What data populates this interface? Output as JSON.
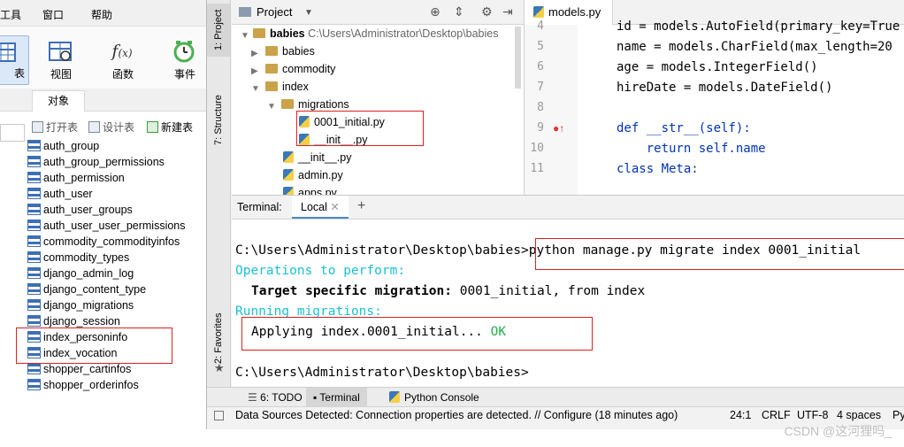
{
  "menubar": {
    "items": [
      "工具",
      "窗口",
      "帮助"
    ]
  },
  "ribbon": {
    "buttons": [
      {
        "label": "表",
        "icon": "table-icon"
      },
      {
        "label": "视图",
        "icon": "view-icon"
      },
      {
        "label": "函数",
        "icon": "function-icon"
      },
      {
        "label": "事件",
        "icon": "event-clock-icon"
      }
    ]
  },
  "objects": {
    "tab_label": "对象",
    "toolbar": {
      "open_table": "打开表",
      "design_table": "设计表",
      "new_table": "新建表"
    },
    "tables": [
      "auth_group",
      "auth_group_permissions",
      "auth_permission",
      "auth_user",
      "auth_user_groups",
      "auth_user_user_permissions",
      "commodity_commodityinfos",
      "commodity_types",
      "django_admin_log",
      "django_content_type",
      "django_migrations",
      "django_session",
      "index_personinfo",
      "index_vocation",
      "shopper_cartinfos",
      "shopper_orderinfos"
    ]
  },
  "ide": {
    "side_tabs": [
      "1: Project",
      "7: Structure",
      "2: Favorites"
    ],
    "project": {
      "title": "Project",
      "root_name": "babies",
      "root_path": "C:\\Users\\Administrator\\Desktop\\babies",
      "items": [
        "babies",
        "commodity",
        "index",
        "migrations",
        "0001_initial.py",
        "__init__.py",
        "__init__.py",
        "admin.py",
        "apps.py"
      ]
    },
    "editor": {
      "tab": "models.py",
      "line_numbers": [
        "4",
        "5",
        "6",
        "7",
        "8",
        "9",
        "10",
        "11"
      ],
      "lines": [
        "id = models.AutoField(primary_key=True",
        "name = models.CharField(max_length=20",
        "age = models.IntegerField()",
        "hireDate = models.DateField()",
        "",
        "def __str__(self):",
        "    return self.name",
        "class Meta:"
      ]
    },
    "terminal": {
      "label": "Terminal:",
      "tab": "Local",
      "add": "+",
      "prompt1": "C:\\Users\\Administrator\\Desktop\\babies>",
      "command": "python manage.py migrate index 0001_initial",
      "ops": "Operations to perform:",
      "target_label": "Target specific migration:",
      "target_rest": " 0001_initial, from index",
      "running": "Running migrations:",
      "applying": "Applying index.0001_initial...",
      "ok": "OK",
      "prompt2": "C:\\Users\\Administrator\\Desktop\\babies>"
    },
    "bottom_tabs": [
      "6: TODO",
      "Terminal",
      "Python Console"
    ],
    "status": {
      "message": "Data Sources Detected: Connection properties are detected. // Configure (18 minutes ago)",
      "position": "24:1",
      "line_sep": "CRLF",
      "encoding": "UTF-8",
      "indent": "4 spaces",
      "interp": "Py"
    }
  },
  "watermark": "CSDN @这河狸吗_"
}
